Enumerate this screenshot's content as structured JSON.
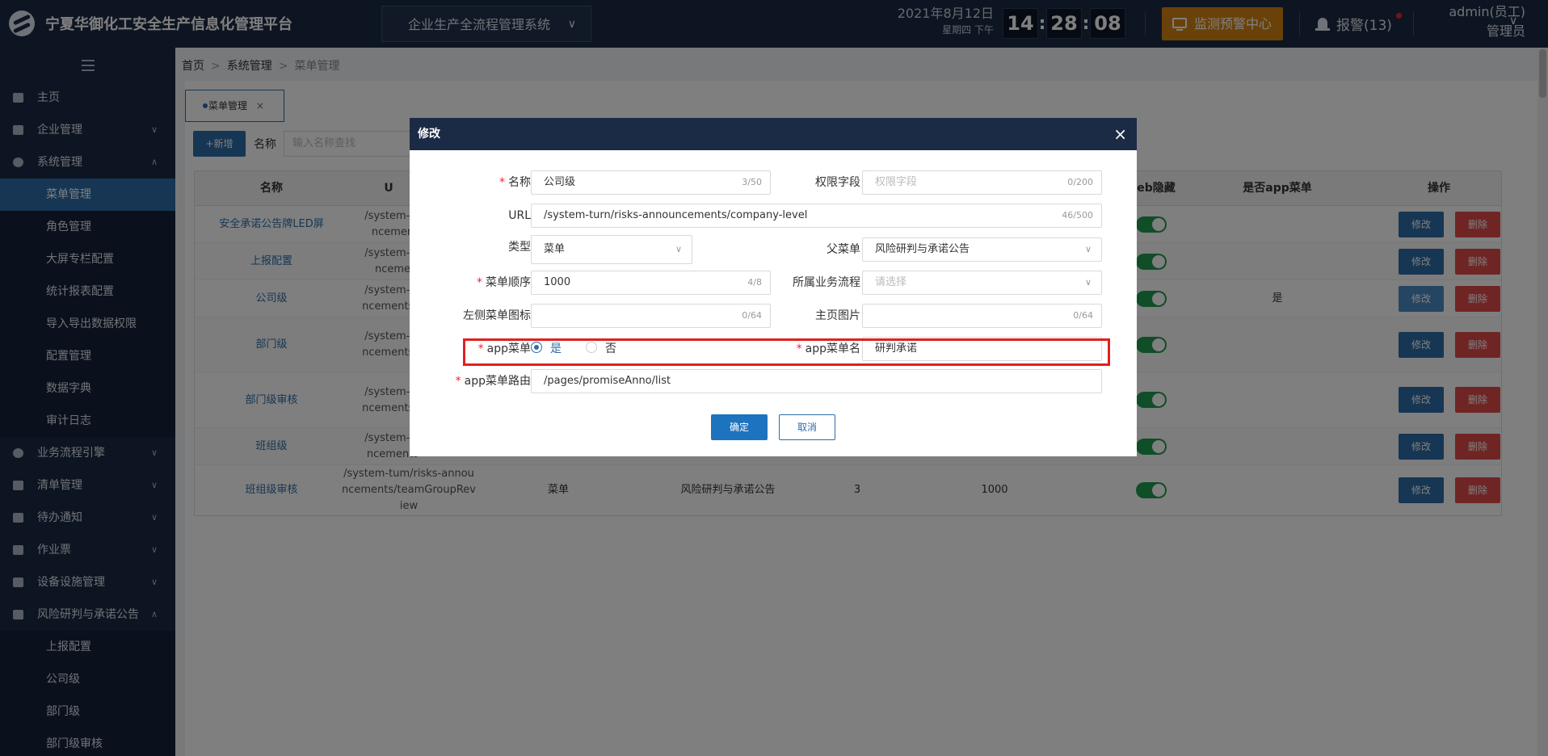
{
  "header": {
    "app_title": "宁夏华御化工安全生产信息化管理平台",
    "system_select": "企业生产全流程管理系统",
    "date": "2021年8月12日",
    "weekday": "星期四 下午",
    "clock": {
      "h": "14",
      "m": "28",
      "s": "08"
    },
    "monitor_label": "监测预警中心",
    "alarm_label": "报警(13)",
    "user_name": "admin(员工)",
    "user_role": "管理员"
  },
  "sidebar": {
    "items": [
      {
        "label": "主页",
        "icon": "home-icon"
      },
      {
        "label": "企业管理",
        "icon": "building-icon"
      },
      {
        "label": "系统管理",
        "icon": "gear-icon"
      },
      {
        "label": "菜单管理"
      },
      {
        "label": "角色管理"
      },
      {
        "label": "大屏专栏配置"
      },
      {
        "label": "统计报表配置"
      },
      {
        "label": "导入导出数据权限"
      },
      {
        "label": "配置管理"
      },
      {
        "label": "数据字典"
      },
      {
        "label": "审计日志"
      },
      {
        "label": "业务流程引擎",
        "icon": "flow-icon"
      },
      {
        "label": "清单管理",
        "icon": "list-icon"
      },
      {
        "label": "待办通知",
        "icon": "mail-icon"
      },
      {
        "label": "作业票",
        "icon": "ticket-icon"
      },
      {
        "label": "设备设施管理",
        "icon": "device-icon"
      },
      {
        "label": "风险研判与承诺公告",
        "icon": "briefcase-icon"
      },
      {
        "label": "上报配置"
      },
      {
        "label": "公司级"
      },
      {
        "label": "部门级"
      },
      {
        "label": "部门级审核"
      }
    ]
  },
  "breadcrumb": [
    "首页",
    "系统管理",
    "菜单管理"
  ],
  "tab": {
    "label": "菜单管理",
    "close": "×"
  },
  "toolbar": {
    "add_label": "+新增",
    "name_label": "名称",
    "search_placeholder": "输入名称查找"
  },
  "table": {
    "headers": [
      "名称",
      "U",
      "eb隐藏",
      "是否app菜单",
      "操作"
    ],
    "rows": [
      {
        "name": "安全承诺公告牌LED屏",
        "url": "/system-tu\nncemen",
        "app": "",
        "edit": "修改",
        "del": "删除"
      },
      {
        "name": "上报配置",
        "url": "/system-tu\nnceme",
        "app": "",
        "edit": "修改",
        "del": "删除"
      },
      {
        "name": "公司级",
        "url": "/system-tu\nncements/c",
        "app": "是",
        "edit": "修改",
        "del": "删除"
      },
      {
        "name": "部门级",
        "url": "/system-tu\nncements/c",
        "app": "",
        "edit": "修改",
        "del": "删除"
      },
      {
        "name": "部门级审核",
        "url": "/system-tu\nncements/c",
        "app": "",
        "edit": "修改",
        "del": "删除"
      },
      {
        "name": "班组级",
        "url": "/system-tu\nncements",
        "app": "",
        "edit": "修改",
        "del": "删除"
      },
      {
        "name": "班组级审核",
        "url": "/system-tum/risks-annou\nncements/teamGroupRev\niew",
        "type": "菜单",
        "parent": "风险研判与承诺公告",
        "level": "3",
        "order": "1000",
        "app": "",
        "edit": "修改",
        "del": "删除"
      }
    ]
  },
  "modal": {
    "title": "修改",
    "close": "×",
    "name_label": "名称",
    "name_value": "公司级",
    "name_count": "3/50",
    "perm_label": "权限字段",
    "perm_placeholder": "权限字段",
    "perm_count": "0/200",
    "url_label": "URL",
    "url_value": "/system-turn/risks-announcements/company-level",
    "url_count": "46/500",
    "type_label": "类型",
    "type_value": "菜单",
    "parent_label": "父菜单",
    "parent_value": "风险研判与承诺公告",
    "order_label": "菜单顺序",
    "order_value": "1000",
    "order_count": "4/8",
    "flow_label": "所属业务流程",
    "flow_placeholder": "请选择",
    "icon_label": "左侧菜单图标",
    "icon_count": "0/64",
    "img_label": "主页图片",
    "img_count": "0/64",
    "app_label": "app菜单",
    "app_yes": "是",
    "app_no": "否",
    "appname_label": "app菜单名",
    "appname_value": "研判承诺",
    "approute_label": "app菜单路由",
    "approute_value": "/pages/promiseAnno/list",
    "ok_label": "确定",
    "cancel_label": "取消"
  },
  "colors": {
    "nav_bg": "#1c2b45",
    "accent": "#2d6ca8",
    "warning": "#d48413",
    "danger": "#e14b4b",
    "success": "#1e9c4e",
    "highlight": "#e02020"
  }
}
